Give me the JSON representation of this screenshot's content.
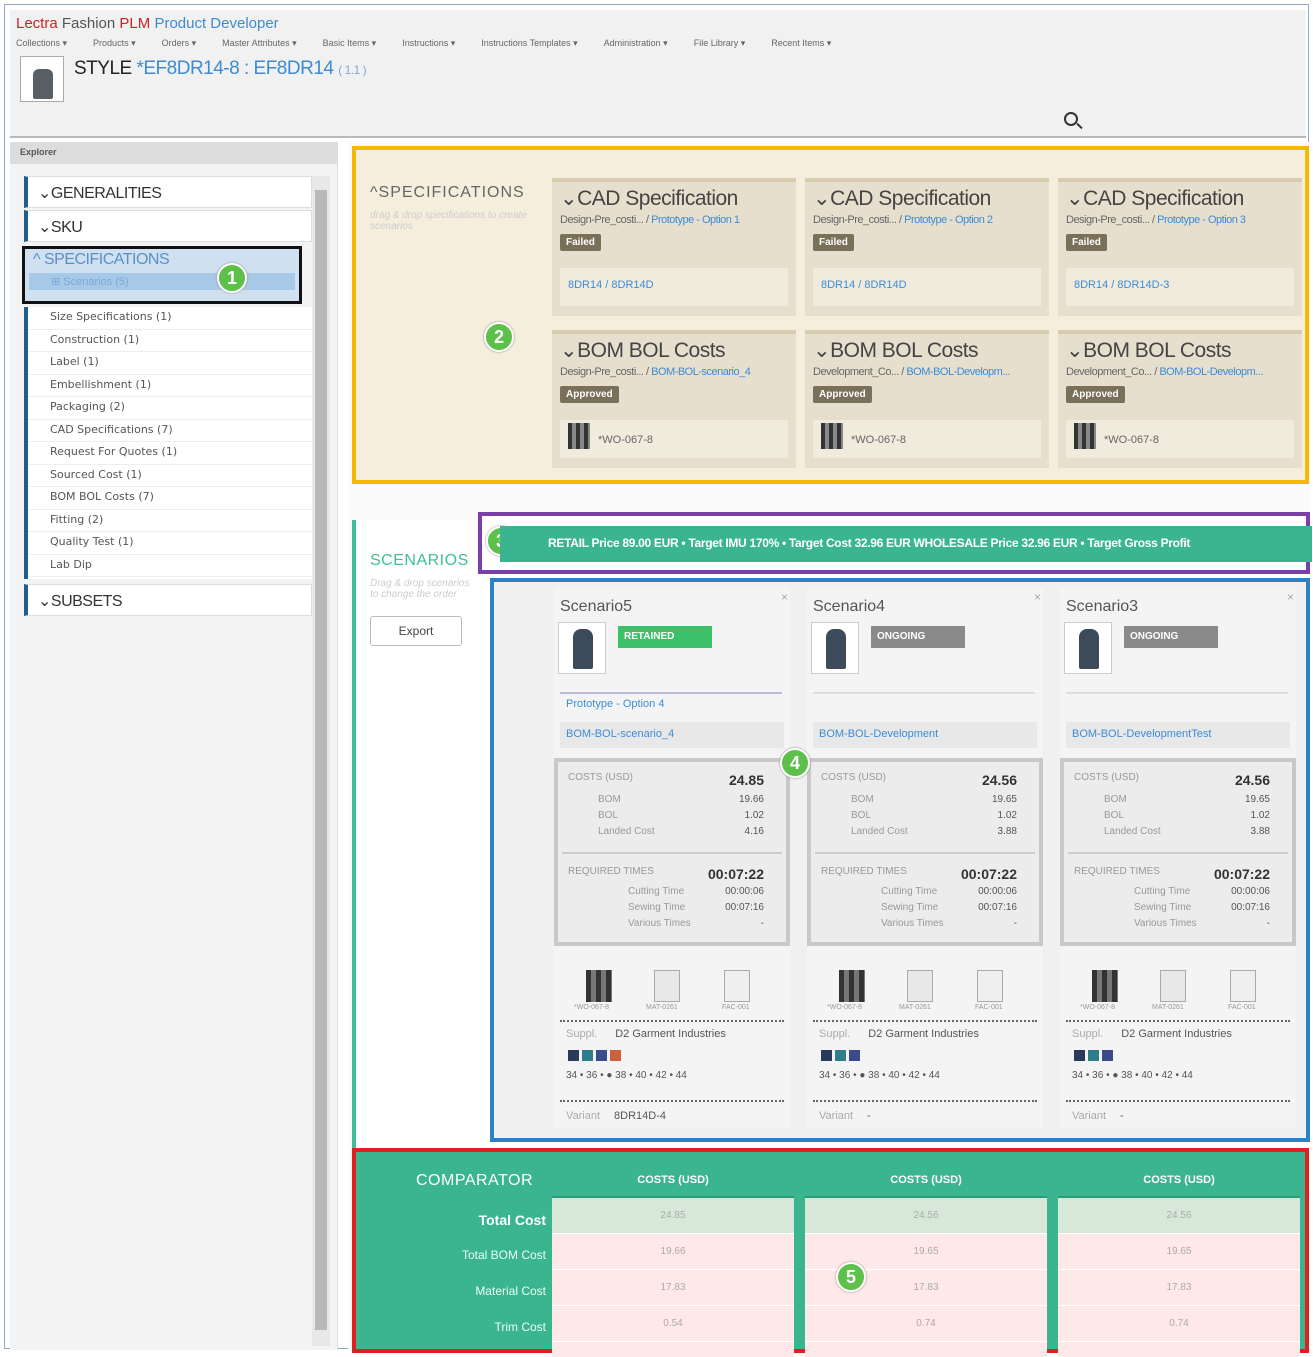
{
  "app": {
    "brand_lectra": "Lectra",
    "brand_fashion": "Fashion",
    "brand_plm": "PLM",
    "brand_product": "Product Developer"
  },
  "menu": [
    "Collections ▾",
    "Products ▾",
    "Orders ▾",
    "Master Attributes ▾",
    "Basic Items ▾",
    "Instructions ▾",
    "Instructions Templates ▾",
    "Administration ▾",
    "File Library ▾",
    "Recent Items ▾"
  ],
  "style": {
    "prefix": "STYLE",
    "code": "*EF8DR14-8 : EF8DR14",
    "version": "( 1.1 )"
  },
  "explorer": {
    "title": "Explorer",
    "generalities": "GENERALITIES",
    "sku": "SKU",
    "specifications": "SPECIFICATIONS",
    "scenarios": "Scenarios (5)",
    "tree": [
      "Size Specifications (1)",
      "Construction (1)",
      "Label (1)",
      "Embellishment (1)",
      "Packaging (2)",
      "CAD Specifications (7)",
      "Request For Quotes (1)",
      "Sourced Cost (1)",
      "BOM BOL Costs (7)",
      "Fitting (2)",
      "Quality Test (1)",
      "Lab Dip"
    ],
    "subsets": "SUBSETS"
  },
  "specs": {
    "heading": "SPECIFICATIONS",
    "hint": "drag & drop specifications to create scenarios",
    "cad": [
      {
        "title": "CAD Specification",
        "src": "Design-Pre_costi...",
        "link": "Prototype - Option 1",
        "status": "Failed",
        "foot": "8DR14 / 8DR14D"
      },
      {
        "title": "CAD Specification",
        "src": "Design-Pre_costi...",
        "link": "Prototype - Option 2",
        "status": "Failed",
        "foot": "8DR14 / 8DR14D"
      },
      {
        "title": "CAD Specification",
        "src": "Design-Pre_costi...",
        "link": "Prototype - Option 3",
        "status": "Failed",
        "foot": "8DR14 / 8DR14D-3"
      }
    ],
    "bom": [
      {
        "title": "BOM BOL Costs",
        "src": "Design-Pre_costi...",
        "link": "BOM-BOL-scenario_4",
        "status": "Approved",
        "foot": "*WO-067-8"
      },
      {
        "title": "BOM BOL Costs",
        "src": "Development_Co...",
        "link": "BOM-BOL-Developm...",
        "status": "Approved",
        "foot": "*WO-067-8"
      },
      {
        "title": "BOM BOL Costs",
        "src": "Development_Co...",
        "link": "BOM-BOL-Developm...",
        "status": "Approved",
        "foot": "*WO-067-8"
      }
    ]
  },
  "pricebar": "RETAIL  Price  89.00 EUR  •  Target IMU  170%  •  Target Cost  32.96 EUR    WHOLESALE  Price  32.96 EUR  •  Target Gross Profit",
  "scenarios": {
    "heading": "SCENARIOS",
    "hint": "Drag & drop scenarios to change the order",
    "export": "Export",
    "cards": [
      {
        "name": "Scenario5",
        "status": "RETAINED",
        "status_color": "#3cc06a",
        "proto": "Prototype - Option 4",
        "bom": "BOM-BOL-scenario_4",
        "costs_label": "COSTS (USD)",
        "total": "24.85",
        "bom_v": "19.66",
        "bol_v": "1.02",
        "landed": "4.16",
        "times_label": "REQUIRED TIMES",
        "time_total": "00:07:22",
        "cutting": "00:00:06",
        "sewing": "00:07:16",
        "various": "-",
        "supplier": "D2 Garment Industries",
        "sizes": "34 • 36 • ● 38 • 40 • 42 • 44",
        "variant": "8DR14D-4",
        "colors": [
          "#2a3a5a",
          "#2e7d8a",
          "#3a4a8a",
          "#d0603a"
        ]
      },
      {
        "name": "Scenario4",
        "status": "ONGOING",
        "status_color": "#8a8a8a",
        "proto": "",
        "bom": "BOM-BOL-Development",
        "costs_label": "COSTS (USD)",
        "total": "24.56",
        "bom_v": "19.65",
        "bol_v": "1.02",
        "landed": "3.88",
        "times_label": "REQUIRED TIMES",
        "time_total": "00:07:22",
        "cutting": "00:00:06",
        "sewing": "00:07:16",
        "various": "-",
        "supplier": "D2 Garment Industries",
        "sizes": "34 • 36 • ● 38 • 40 • 42 • 44",
        "variant": "-",
        "colors": [
          "#2a3a5a",
          "#2e7d8a",
          "#3a4a8a"
        ]
      },
      {
        "name": "Scenario3",
        "status": "ONGOING",
        "status_color": "#8a8a8a",
        "proto": "",
        "bom": "BOM-BOL-DevelopmentTest",
        "costs_label": "COSTS (USD)",
        "total": "24.56",
        "bom_v": "19.65",
        "bol_v": "1.02",
        "landed": "3.88",
        "times_label": "REQUIRED TIMES",
        "time_total": "00:07:22",
        "cutting": "00:00:06",
        "sewing": "00:07:16",
        "various": "-",
        "supplier": "D2 Garment Industries",
        "sizes": "34 • 36 • ● 38 • 40 • 42 • 44",
        "variant": "-",
        "colors": [
          "#2a3a5a",
          "#2e7d8a",
          "#3a4a8a"
        ]
      }
    ],
    "row_labels": {
      "bom": "BOM",
      "bol": "BOL",
      "landed": "Landed Cost",
      "cutting": "Cutting Time",
      "sewing": "Sewing Time",
      "various": "Various Times",
      "supplier": "Suppl.",
      "variant": "Variant"
    },
    "mat_labels": [
      "*WO-067-8",
      "MAT-0261",
      "FAC-001"
    ]
  },
  "comparator": {
    "title": "COMPARATOR",
    "labels": [
      "Total Cost",
      "Total BOM Cost",
      "Material Cost",
      "Trim Cost"
    ],
    "columns": [
      {
        "header": "COSTS (USD)",
        "values": [
          "24.85",
          "19.66",
          "17.83",
          "0.54"
        ]
      },
      {
        "header": "COSTS (USD)",
        "values": [
          "24.56",
          "19.65",
          "17.83",
          "0.74"
        ]
      },
      {
        "header": "COSTS (USD)",
        "values": [
          "24.56",
          "19.65",
          "17.83",
          "0.74"
        ]
      }
    ]
  },
  "badges": [
    "1",
    "2",
    "3",
    "4",
    "5"
  ],
  "colors": {
    "spec_border": "#f5b800",
    "price_border": "#7a3fa8",
    "scen_border": "#2f7fc4",
    "comp_border": "#e02020",
    "accent": "#3ab58f"
  }
}
